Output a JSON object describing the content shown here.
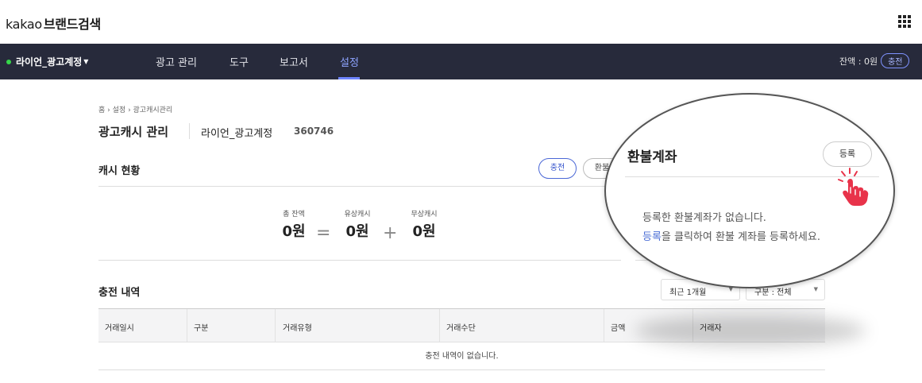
{
  "header": {
    "logo_kakao": "kakao",
    "logo_brand": "브랜드검색",
    "apps_icon": "grid-icon"
  },
  "nav": {
    "account": "라이언_광고계정",
    "menu": [
      "광고 관리",
      "도구",
      "보고서",
      "설정"
    ],
    "active": "설정",
    "balance": "잔액 : 0원",
    "charge": "충전"
  },
  "breadcrumb": [
    "홈",
    "설정",
    "광고캐시관리"
  ],
  "page": {
    "title": "광고캐시 관리",
    "account_name": "라이언_광고계정",
    "account_id": "360746"
  },
  "cash": {
    "title": "캐시 현황",
    "charge_btn": "충전",
    "refund_btn": "환불",
    "total_label": "총 잔액",
    "total_value": "0원",
    "paid_label": "유상캐시",
    "paid_value": "0원",
    "free_label": "무상캐시",
    "free_value": "0원",
    "equals": "=",
    "plus": "+"
  },
  "history": {
    "title": "충전 내역",
    "period": "최근 1개월",
    "filter": "구분 : 전체",
    "columns": [
      "거래일시",
      "구분",
      "거래유형",
      "거래수단",
      "금액",
      "거래자"
    ],
    "empty": "충전 내역이 없습니다."
  },
  "refund_account": {
    "title": "환불계좌",
    "register_btn": "등록",
    "empty_line1": "등록한 환불계좌가 없습니다.",
    "link": "등록",
    "empty_line2": "을 클릭하여 환불 계좌를 등록하세요."
  },
  "colors": {
    "nav_bg": "#272a3b",
    "accent": "#4c6fd6",
    "active_dot": "#36d64a",
    "hand": "#e8334a"
  }
}
